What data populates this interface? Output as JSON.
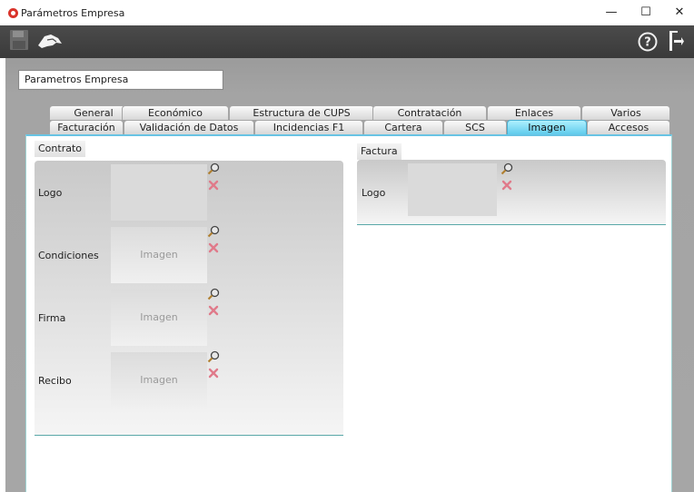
{
  "window": {
    "title": "Parámetros Empresa",
    "controls": {
      "minimize": "—",
      "maximize": "☐",
      "close": "✕"
    }
  },
  "toolbar": {
    "icons": [
      "save-icon",
      "handshake-icon",
      "help-icon",
      "exit-icon"
    ],
    "help_glyph": "?"
  },
  "header": {
    "title": "Parametros Empresa"
  },
  "tabs_row1": [
    "General",
    "Económico",
    "Estructura de CUPS",
    "Contratación",
    "Enlaces",
    "Varios"
  ],
  "tabs_row2": [
    "Facturación",
    "Validación de Datos",
    "Incidencias F1",
    "Cartera",
    "SCS",
    "Imagen",
    "Accesos"
  ],
  "active_tab": "Imagen",
  "contrato": {
    "label": "Contrato",
    "fields": [
      {
        "label": "Logo",
        "image_text": ""
      },
      {
        "label": "Condiciones",
        "image_text": "Imagen"
      },
      {
        "label": "Firma",
        "image_text": "Imagen"
      },
      {
        "label": "Recibo",
        "image_text": "Imagen"
      }
    ]
  },
  "factura": {
    "label": "Factura",
    "fields": [
      {
        "label": "Logo",
        "image_text": ""
      }
    ]
  },
  "colors": {
    "toolbar": "#3f3f3f",
    "active_tab": "#5fcbec",
    "delete_icon": "#e07a8a",
    "panel_border": "#5aa8a8"
  }
}
